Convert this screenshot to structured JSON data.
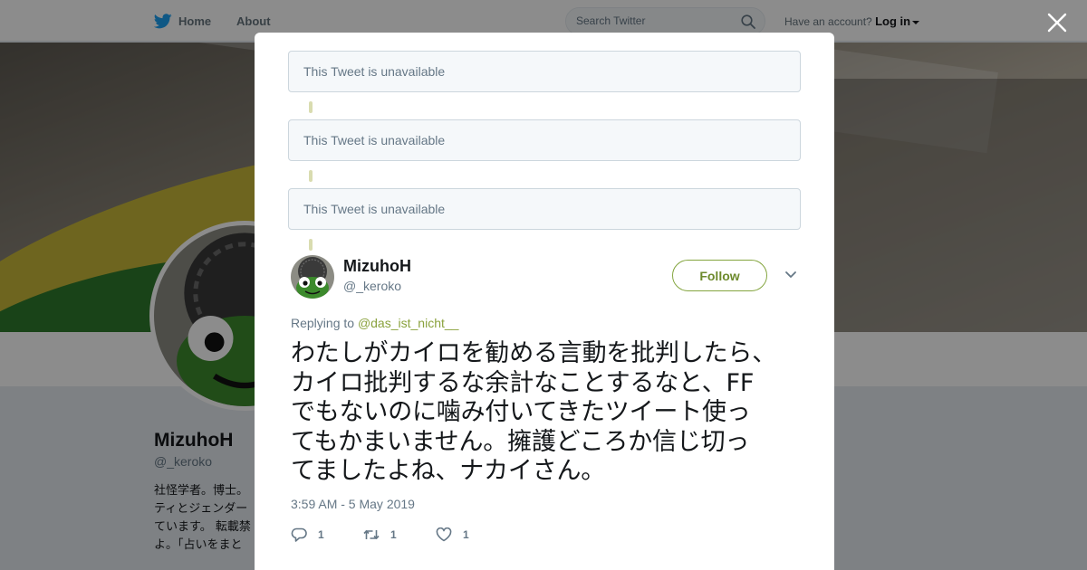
{
  "topbar": {
    "home_label": "Home",
    "about_label": "About",
    "search_placeholder": "Search Twitter",
    "account_prompt": "Have an account?",
    "login_label": "Log in"
  },
  "profile": {
    "name": "MizuhoH",
    "handle": "@_keroko",
    "bio_lines": [
      "社怪学者。博士。",
      "ティとジェンダー",
      "ています。 転載禁",
      "よ。「占いをまと"
    ]
  },
  "modal": {
    "unavailable_tweets": [
      "This Tweet is unavailable",
      "This Tweet is unavailable",
      "This Tweet is unavailable"
    ],
    "tweet": {
      "author_name": "MizuhoH",
      "author_handle": "@_keroko",
      "follow_label": "Follow",
      "replying_prefix": "Replying to",
      "replying_to": "@das_ist_nicht__",
      "text_lines": [
        "わたしがカイロを勧める言動を批判したら、",
        "カイロ批判するな余計なことするなと、FF",
        "でもないのに噛み付いてきたツイート使っ",
        "てもかまいません。擁護どころか信じ切っ",
        "てましたよね、ナカイさん。"
      ],
      "timestamp": "3:59 AM - 5 May 2019",
      "reply_count": "1",
      "retweet_count": "1",
      "like_count": "1"
    }
  },
  "colors": {
    "twitter_blue": "#1da1f2",
    "accent_green": "#84a53f",
    "muted_text": "#657786"
  },
  "icons": [
    "twitter-bird-icon",
    "search-icon",
    "close-icon",
    "chevron-down-icon",
    "reply-icon",
    "retweet-icon",
    "heart-icon"
  ]
}
